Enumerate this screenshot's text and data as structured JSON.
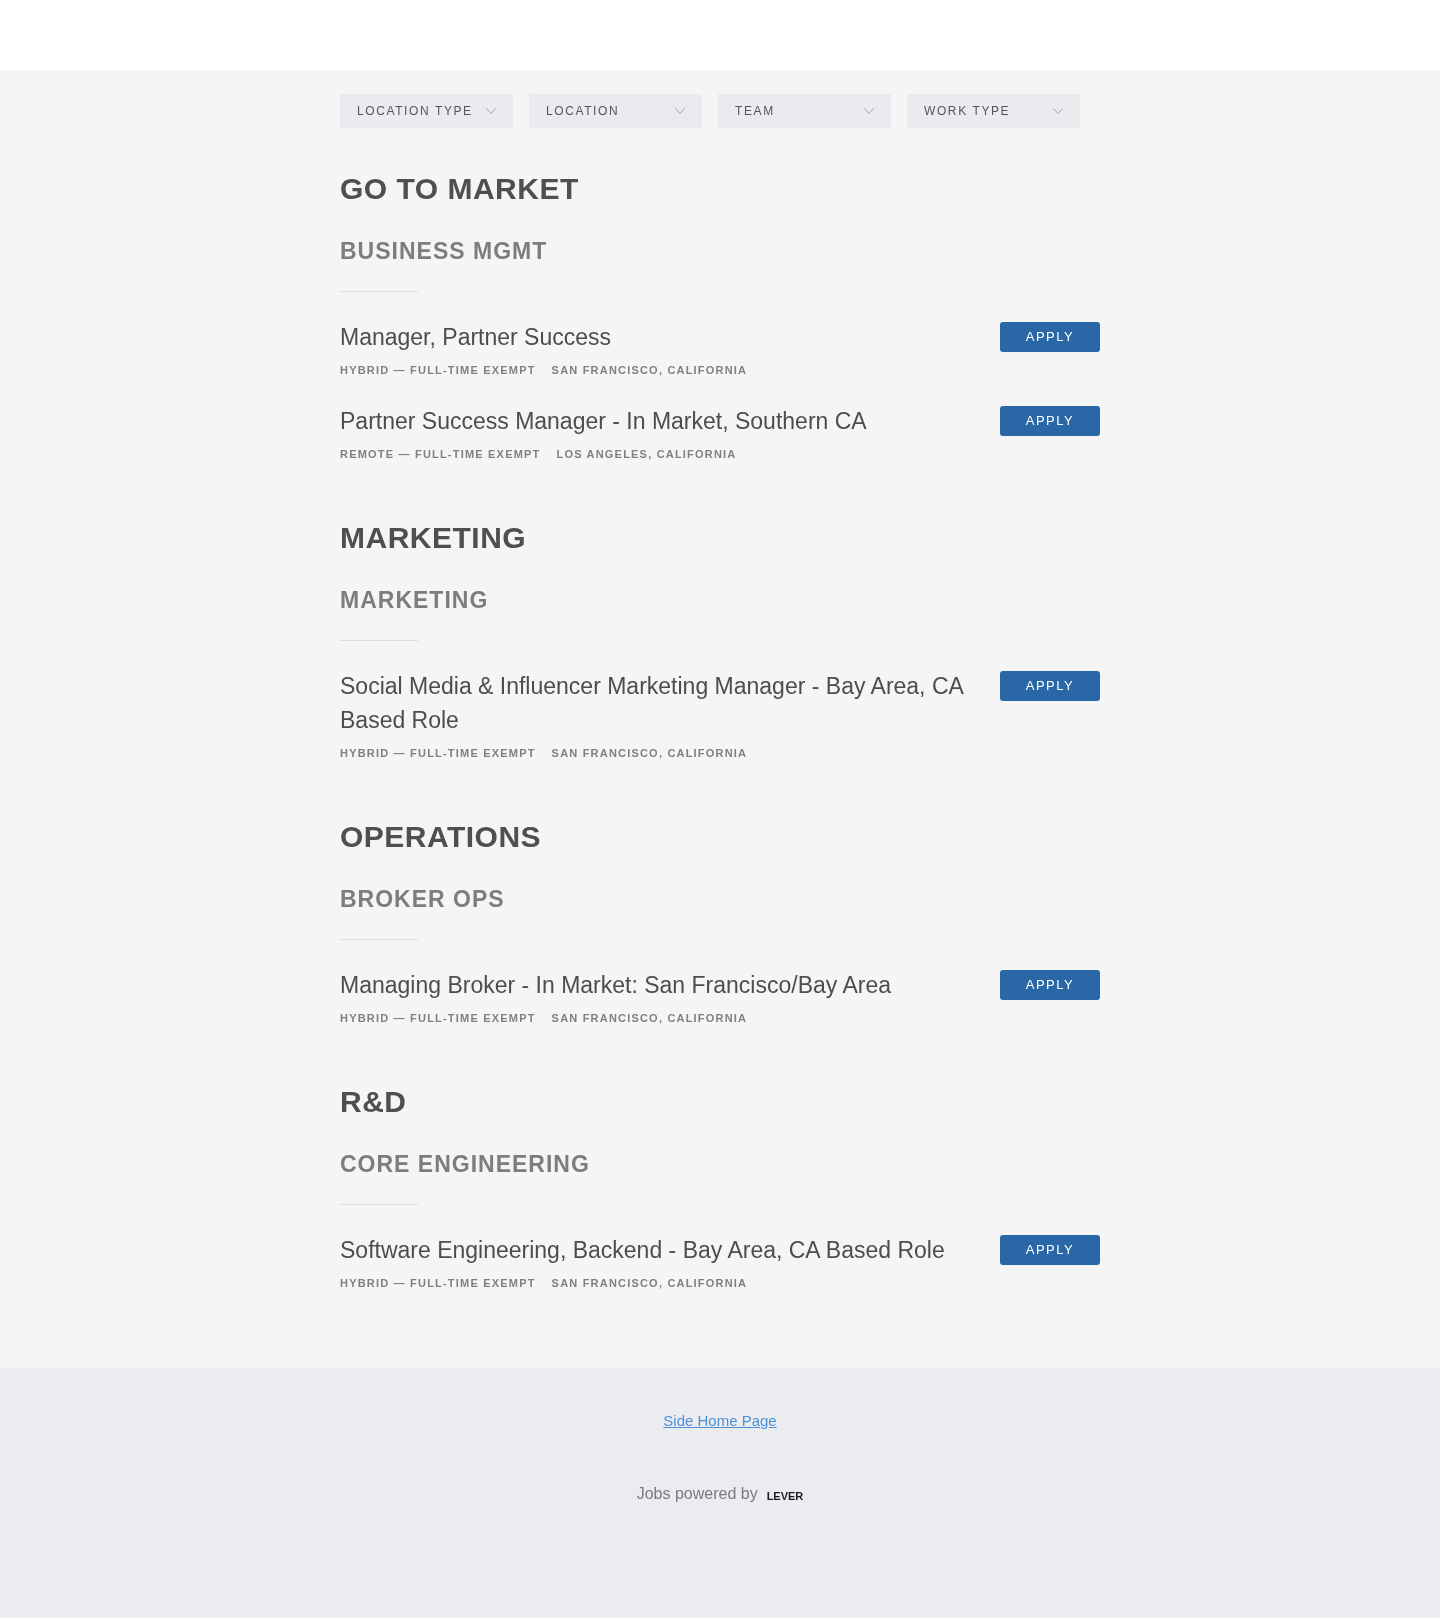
{
  "filters": [
    {
      "label": "LOCATION TYPE"
    },
    {
      "label": "LOCATION"
    },
    {
      "label": "TEAM"
    },
    {
      "label": "WORK TYPE"
    }
  ],
  "departments": [
    {
      "name": "GO TO MARKET",
      "teams": [
        {
          "name": "BUSINESS MGMT",
          "postings": [
            {
              "title": "Manager, Partner Success",
              "commitment": "HYBRID — FULL-TIME EXEMPT",
              "location": "SAN FRANCISCO, CALIFORNIA",
              "button": "APPLY"
            },
            {
              "title": "Partner Success Manager - In Market, Southern CA",
              "commitment": "REMOTE — FULL-TIME EXEMPT",
              "location": "LOS ANGELES, CALIFORNIA",
              "button": "APPLY"
            }
          ]
        }
      ]
    },
    {
      "name": "MARKETING",
      "teams": [
        {
          "name": "MARKETING",
          "postings": [
            {
              "title": "Social Media & Influencer Marketing Manager - Bay Area, CA Based Role",
              "commitment": "HYBRID — FULL-TIME EXEMPT",
              "location": "SAN FRANCISCO, CALIFORNIA",
              "button": "APPLY"
            }
          ]
        }
      ]
    },
    {
      "name": "OPERATIONS",
      "teams": [
        {
          "name": "BROKER OPS",
          "postings": [
            {
              "title": "Managing Broker - In Market: San Francisco/Bay Area",
              "commitment": "HYBRID — FULL-TIME EXEMPT",
              "location": "SAN FRANCISCO, CALIFORNIA",
              "button": "APPLY"
            }
          ]
        }
      ]
    },
    {
      "name": "R&D",
      "teams": [
        {
          "name": "CORE ENGINEERING",
          "postings": [
            {
              "title": "Software Engineering, Backend - Bay Area, CA Based Role",
              "commitment": "HYBRID — FULL-TIME EXEMPT",
              "location": "SAN FRANCISCO, CALIFORNIA",
              "button": "APPLY"
            }
          ]
        }
      ]
    }
  ],
  "footer": {
    "link": "Side Home Page",
    "powered_by": "Jobs powered by",
    "logo": "LEVER"
  }
}
